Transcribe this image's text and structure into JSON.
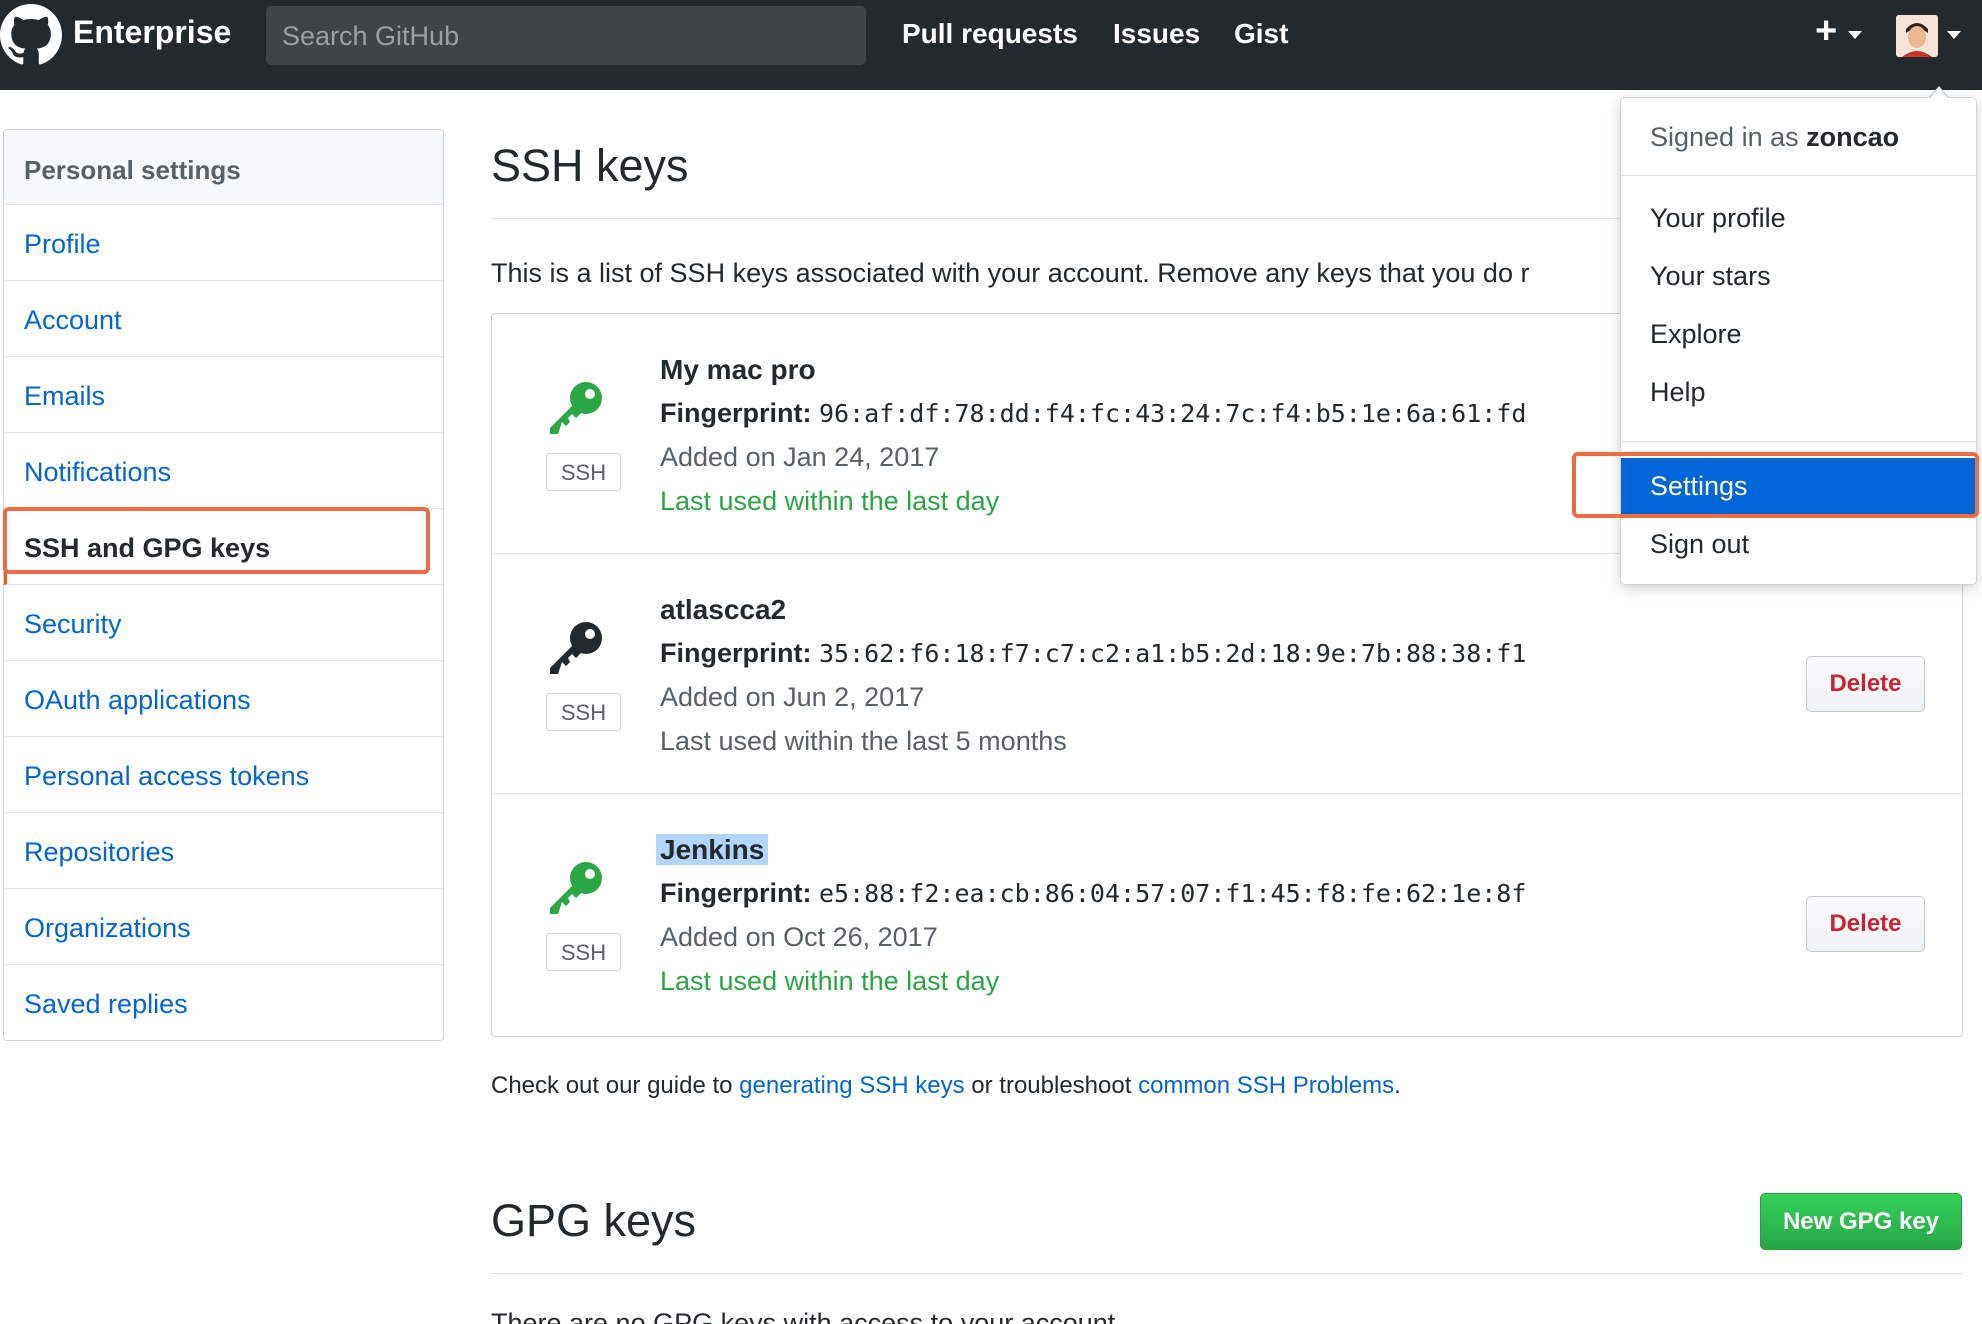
{
  "header": {
    "brand": "Enterprise",
    "search_placeholder": "Search GitHub",
    "nav": [
      "Pull requests",
      "Issues",
      "Gist"
    ],
    "plus": "+"
  },
  "sidebar": {
    "title": "Personal settings",
    "items": [
      {
        "label": "Profile"
      },
      {
        "label": "Account"
      },
      {
        "label": "Emails"
      },
      {
        "label": "Notifications"
      },
      {
        "label": "SSH and GPG keys",
        "selected": true
      },
      {
        "label": "Security"
      },
      {
        "label": "OAuth applications"
      },
      {
        "label": "Personal access tokens"
      },
      {
        "label": "Repositories"
      },
      {
        "label": "Organizations"
      },
      {
        "label": "Saved replies"
      }
    ]
  },
  "ssh": {
    "heading": "SSH keys",
    "intro": "This is a list of SSH keys associated with your account. Remove any keys that you do r",
    "badge": "SSH",
    "fingerprint_label": "Fingerprint:",
    "delete_label": "Delete",
    "keys": [
      {
        "title": "My mac pro",
        "fingerprint": "96:af:df:78:dd:f4:fc:43:24:7c:f4:b5:1e:6a:61:fd",
        "added": "Added on Jan 24, 2017",
        "last_used": "Last used within the last day",
        "recent": true,
        "icon_color": "#28a745"
      },
      {
        "title": "atlascca2",
        "fingerprint": "35:62:f6:18:f7:c7:c2:a1:b5:2d:18:9e:7b:88:38:f1",
        "added": "Added on Jun 2, 2017",
        "last_used": "Last used within the last 5 months",
        "recent": false,
        "icon_color": "#24292e"
      },
      {
        "title": "Jenkins",
        "fingerprint": "e5:88:f2:ea:cb:86:04:57:07:f1:45:f8:fe:62:1e:8f",
        "added": "Added on Oct 26, 2017",
        "last_used": "Last used within the last day",
        "recent": true,
        "icon_color": "#28a745"
      }
    ],
    "guide": {
      "prefix": "Check out our guide to ",
      "link1": "generating SSH keys",
      "middle": " or troubleshoot ",
      "link2": "common SSH Problems",
      "suffix": "."
    }
  },
  "gpg": {
    "heading": "GPG keys",
    "new_button": "New GPG key",
    "desc": "There are no GPG keys with access to your account."
  },
  "dropdown": {
    "signed_prefix": "Signed in as ",
    "username": "zoncao",
    "items": [
      {
        "label": "Your profile"
      },
      {
        "label": "Your stars"
      },
      {
        "label": "Explore"
      },
      {
        "label": "Help"
      },
      {
        "label": "Settings",
        "active": true
      },
      {
        "label": "Sign out"
      }
    ]
  },
  "colors": {
    "header_bg": "#24292e",
    "link": "#0366d6",
    "green": "#28a745",
    "danger": "#cb2431",
    "highlight_box": "#ef6c45"
  }
}
